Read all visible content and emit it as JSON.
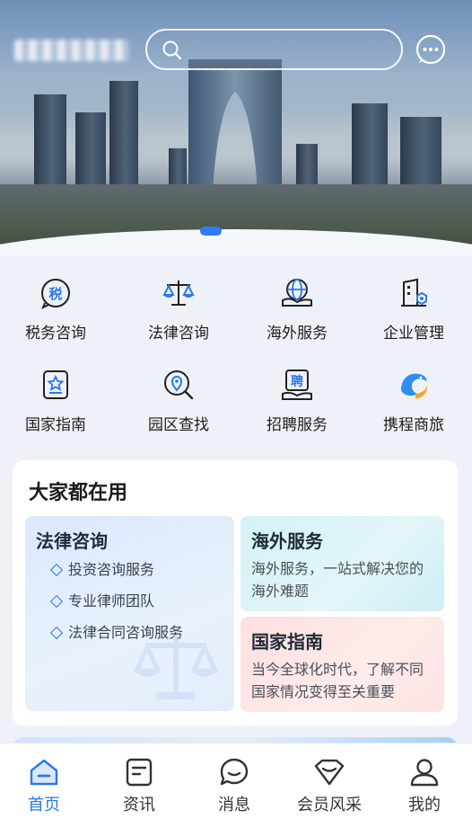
{
  "header": {
    "search": {
      "placeholder": ""
    },
    "logo_text": "",
    "message_icon": "chat-dots-icon"
  },
  "banner": {
    "active_slide_index": 0
  },
  "quick_services": [
    {
      "label": "税务咨询",
      "icon": "tax-icon",
      "glyph": "税"
    },
    {
      "label": "法律咨询",
      "icon": "scales-icon"
    },
    {
      "label": "海外服务",
      "icon": "globe-hand-icon"
    },
    {
      "label": "企业管理",
      "icon": "building-gear-icon"
    },
    {
      "label": "国家指南",
      "icon": "star-document-icon"
    },
    {
      "label": "园区查找",
      "icon": "location-search-icon"
    },
    {
      "label": "招聘服务",
      "icon": "recruit-icon",
      "glyph": "聘"
    },
    {
      "label": "携程商旅",
      "icon": "ctrip-dolphin-icon"
    }
  ],
  "popular": {
    "title": "大家都在用",
    "featured": {
      "title": "法律咨询",
      "items": [
        "投资咨询服务",
        "专业律师团队",
        "法律合同咨询服务"
      ],
      "watermark_icon": "scales-icon"
    },
    "cards": [
      {
        "title": "海外服务",
        "desc": "海外服务，一站式解决您的海外难题"
      },
      {
        "title": "国家指南",
        "desc": "当今全球化时代，了解不同国家情况变得至关重要"
      }
    ]
  },
  "tabbar": {
    "active": "首页",
    "tabs": [
      {
        "label": "首页",
        "icon": "home-icon"
      },
      {
        "label": "资讯",
        "icon": "news-icon"
      },
      {
        "label": "消息",
        "icon": "message-icon"
      },
      {
        "label": "会员风采",
        "icon": "member-icon"
      },
      {
        "label": "我的",
        "icon": "profile-icon"
      }
    ]
  },
  "colors": {
    "accent": "#2a78ea",
    "page_bg": "#eef2f8",
    "card_bg": "#ffffff"
  }
}
